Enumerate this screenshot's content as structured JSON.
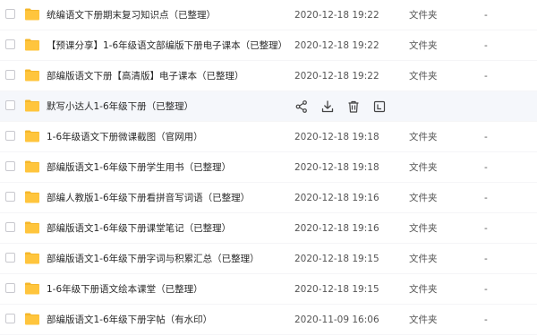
{
  "files": [
    {
      "name": "统编语文下册期末复习知识点（已整理）",
      "date": "2020-12-18 19:22",
      "type": "文件夹",
      "size": "-"
    },
    {
      "name": "【预课分享】1-6年级语文部编版下册电子课本（已整理）",
      "date": "2020-12-18 19:22",
      "type": "文件夹",
      "size": "-"
    },
    {
      "name": "部编版语文下册【高清版】电子课本（已整理）",
      "date": "2020-12-18 19:22",
      "type": "文件夹",
      "size": "-"
    },
    {
      "name": "默写小达人1-6年级下册（已整理）",
      "date": "",
      "type": "",
      "size": ""
    },
    {
      "name": "1-6年级语文下册微课截图（官网用）",
      "date": "2020-12-18 19:18",
      "type": "文件夹",
      "size": "-"
    },
    {
      "name": "部编版语文1-6年级下册学生用书（已整理）",
      "date": "2020-12-18 19:18",
      "type": "文件夹",
      "size": "-"
    },
    {
      "name": "部编人教版1-6年级下册看拼音写词语（已整理）",
      "date": "2020-12-18 19:16",
      "type": "文件夹",
      "size": "-"
    },
    {
      "name": "部编版语文1-6年级下册课堂笔记（已整理）",
      "date": "2020-12-18 19:16",
      "type": "文件夹",
      "size": "-"
    },
    {
      "name": "部编版语文1-6年级下册字词与积累汇总（已整理）",
      "date": "2020-12-18 19:15",
      "type": "文件夹",
      "size": "-"
    },
    {
      "name": "1-6年级下册语文绘本课堂（已整理）",
      "date": "2020-12-18 19:15",
      "type": "文件夹",
      "size": "-"
    },
    {
      "name": "部编版语文1-6年级下册字帖（有水印）",
      "date": "2020-11-09 16:06",
      "type": "文件夹",
      "size": "-"
    }
  ],
  "hovered_row_actions": [
    "share-icon",
    "download-icon",
    "delete-icon",
    "rename-icon"
  ],
  "colors": {
    "folder": "#FFC53D",
    "folder_back": "#F5B72A",
    "hover_bg": "#f5f7fb",
    "icon": "#444444"
  }
}
